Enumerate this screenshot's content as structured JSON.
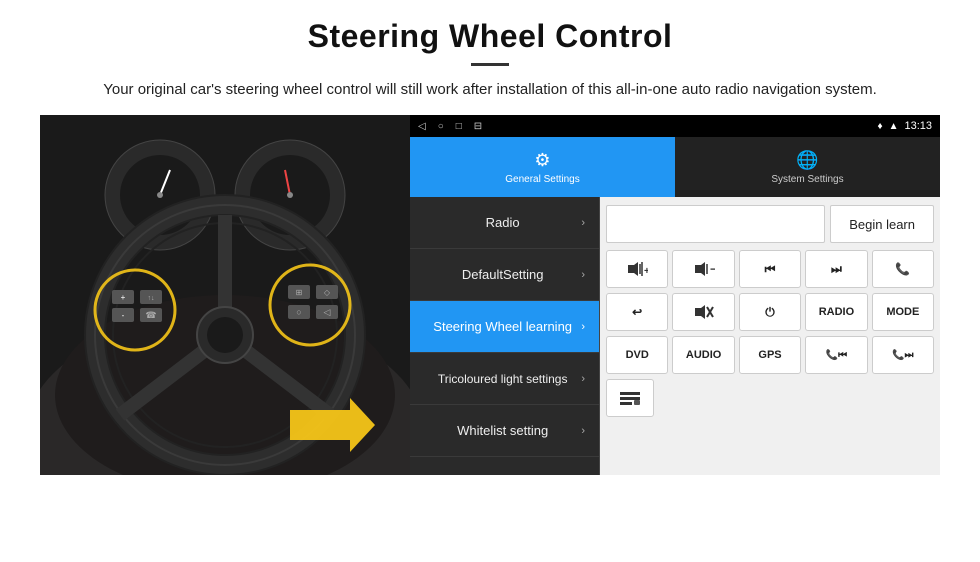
{
  "header": {
    "title": "Steering Wheel Control",
    "subtitle": "Your original car's steering wheel control will still work after installation of this all-in-one auto radio navigation system."
  },
  "status_bar": {
    "icons": [
      "◁",
      "○",
      "□",
      "⊟"
    ],
    "right_icons": "♦ ▲",
    "time": "13:13"
  },
  "tabs": [
    {
      "id": "general",
      "label": "General Settings",
      "icon": "⚙",
      "active": true
    },
    {
      "id": "system",
      "label": "System Settings",
      "icon": "🌐",
      "active": false
    }
  ],
  "menu_items": [
    {
      "id": "radio",
      "label": "Radio",
      "active": false
    },
    {
      "id": "default",
      "label": "DefaultSetting",
      "active": false
    },
    {
      "id": "steering",
      "label": "Steering Wheel learning",
      "active": true
    },
    {
      "id": "tricolour",
      "label": "Tricoloured light settings",
      "active": false
    },
    {
      "id": "whitelist",
      "label": "Whitelist setting",
      "active": false
    }
  ],
  "right_panel": {
    "begin_learn_label": "Begin learn",
    "button_rows": [
      [
        {
          "id": "vol_up",
          "label": "🔊+",
          "type": "icon"
        },
        {
          "id": "vol_down",
          "label": "🔉−",
          "type": "icon"
        },
        {
          "id": "prev_track",
          "label": "⏮",
          "type": "icon"
        },
        {
          "id": "next_track",
          "label": "⏭",
          "type": "icon"
        },
        {
          "id": "phone",
          "label": "📞",
          "type": "icon"
        }
      ],
      [
        {
          "id": "hang_up",
          "label": "↩",
          "type": "icon"
        },
        {
          "id": "mute",
          "label": "🔇x",
          "type": "icon"
        },
        {
          "id": "power",
          "label": "⏻",
          "type": "icon"
        },
        {
          "id": "radio_btn",
          "label": "RADIO",
          "type": "text"
        },
        {
          "id": "mode_btn",
          "label": "MODE",
          "type": "text"
        }
      ],
      [
        {
          "id": "dvd_btn",
          "label": "DVD",
          "type": "text"
        },
        {
          "id": "audio_btn",
          "label": "AUDIO",
          "type": "text"
        },
        {
          "id": "gps_btn",
          "label": "GPS",
          "type": "text"
        },
        {
          "id": "tel_prev",
          "label": "📞⏮",
          "type": "icon"
        },
        {
          "id": "tel_next",
          "label": "📞⏭",
          "type": "icon"
        }
      ]
    ],
    "bottom_icon": "≡"
  }
}
